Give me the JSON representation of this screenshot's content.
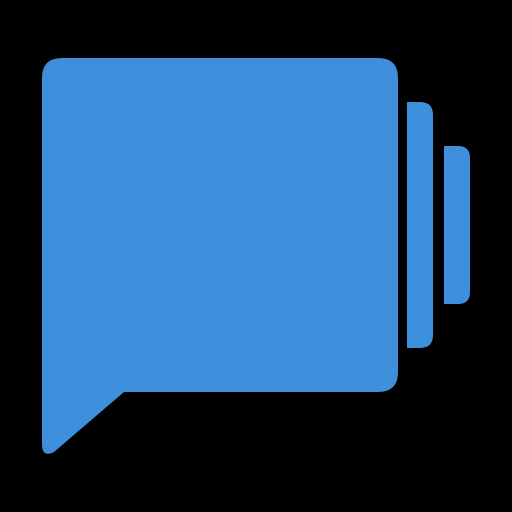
{
  "icon": {
    "name": "chat-bubbles-icon",
    "colors": {
      "background": "#000000",
      "fill": "#3e8fdc",
      "outline": "#000000"
    }
  }
}
